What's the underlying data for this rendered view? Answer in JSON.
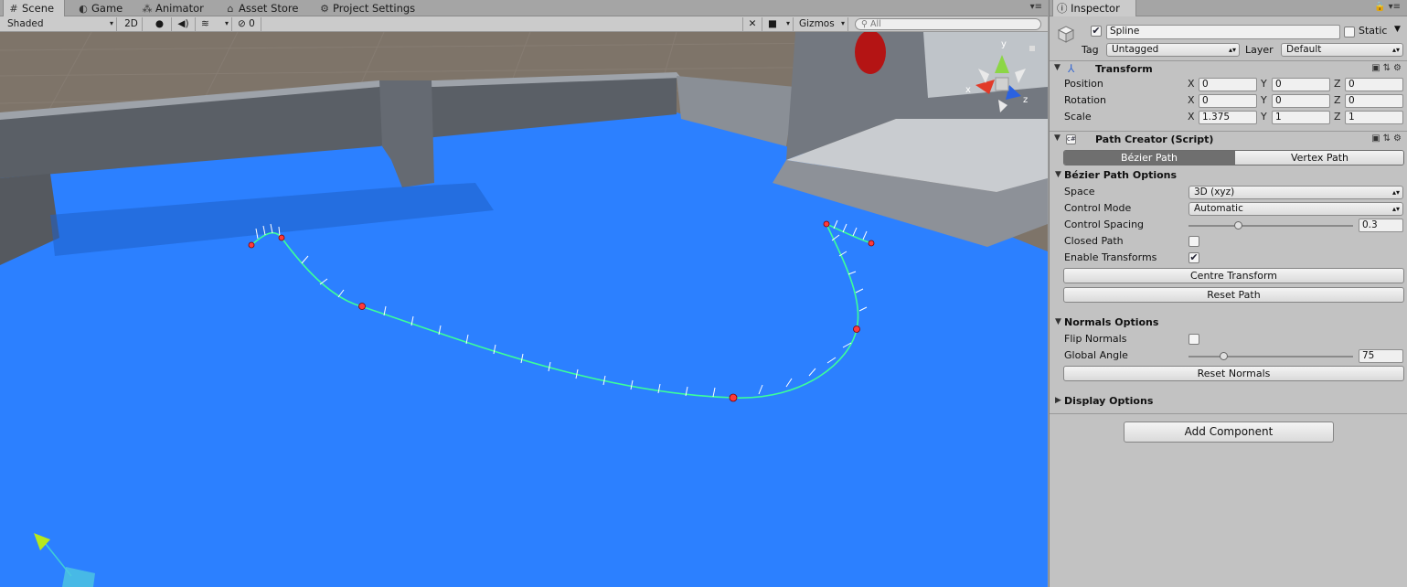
{
  "scene_tabs": [
    {
      "icon": "scene-icon",
      "label": "Scene"
    },
    {
      "icon": "game-icon",
      "label": "Game"
    },
    {
      "icon": "animator-icon",
      "label": "Animator"
    },
    {
      "icon": "asset-store-icon",
      "label": "Asset Store"
    },
    {
      "icon": "gear-icon",
      "label": "Project Settings"
    }
  ],
  "scene_toolbar": {
    "shading": "Shaded",
    "mode_2d": "2D",
    "hidden_count": "0",
    "gizmos": "Gizmos",
    "search_placeholder": "All"
  },
  "scene_view": {
    "gizmo_axes": {
      "y": "y",
      "x": "x",
      "z": "z"
    }
  },
  "inspector": {
    "tab": "Inspector",
    "object": {
      "active": true,
      "name": "Spline",
      "static_label": "Static",
      "static": false
    },
    "tag_label": "Tag",
    "tag": "Untagged",
    "layer_label": "Layer",
    "layer": "Default",
    "transform": {
      "title": "Transform",
      "position_label": "Position",
      "rotation_label": "Rotation",
      "scale_label": "Scale",
      "position": {
        "x": "0",
        "y": "0",
        "z": "0"
      },
      "rotation": {
        "x": "0",
        "y": "0",
        "z": "0"
      },
      "scale": {
        "x": "1.375",
        "y": "1",
        "z": "1"
      }
    },
    "path_creator": {
      "title": "Path Creator (Script)",
      "tab_bezier": "Bézier Path",
      "tab_vertex": "Vertex Path",
      "bezier_options_title": "Bézier Path Options",
      "space_label": "Space",
      "space": "3D (xyz)",
      "control_mode_label": "Control Mode",
      "control_mode": "Automatic",
      "control_spacing_label": "Control Spacing",
      "control_spacing": "0.3",
      "control_spacing_fraction": 0.3,
      "closed_path_label": "Closed Path",
      "closed_path": false,
      "enable_transforms_label": "Enable Transforms",
      "enable_transforms": true,
      "centre_transform_button": "Centre Transform",
      "reset_path_button": "Reset Path",
      "normals_options_title": "Normals Options",
      "flip_normals_label": "Flip Normals",
      "flip_normals": false,
      "global_angle_label": "Global Angle",
      "global_angle": "75",
      "global_angle_fraction": 0.21,
      "reset_normals_button": "Reset Normals",
      "display_options_title": "Display Options"
    },
    "add_component_button": "Add Component"
  }
}
